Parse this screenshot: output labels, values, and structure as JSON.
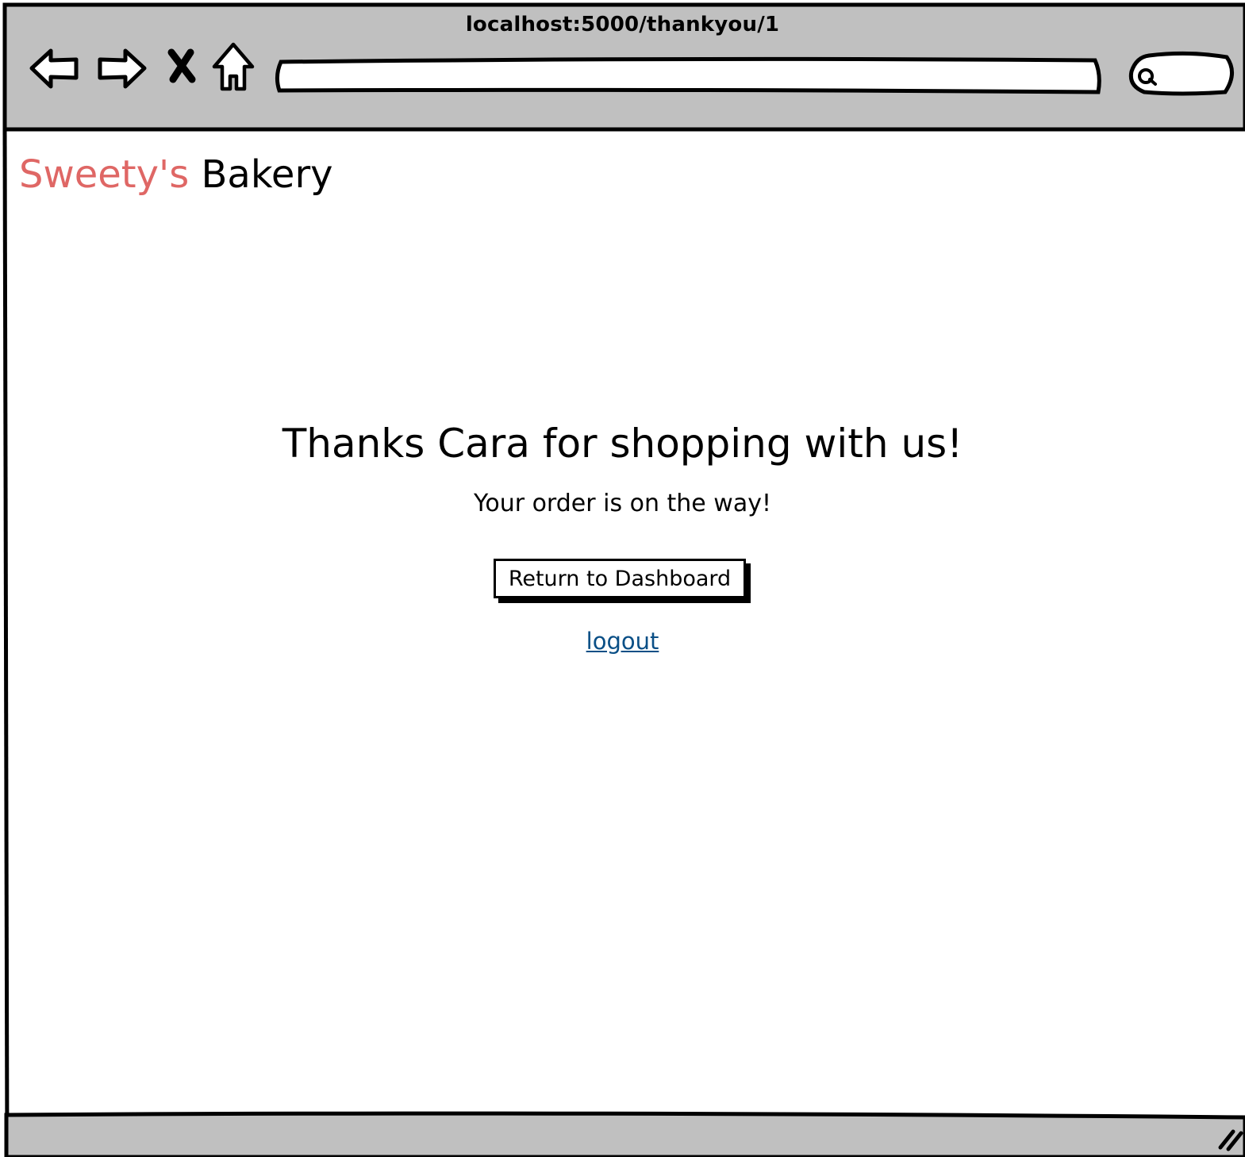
{
  "browser": {
    "url": "localhost:5000/thankyou/1",
    "colors": {
      "chrome": "#c0c0c0",
      "stroke": "#000000"
    },
    "icons": [
      "back-arrow-icon",
      "forward-arrow-icon",
      "close-x-icon",
      "home-icon",
      "search-icon",
      "resize-grip-icon"
    ]
  },
  "header": {
    "brand_part1": "Sweety's",
    "brand_part2": "Bakery",
    "brand_color": "#df6765"
  },
  "main": {
    "heading": "Thanks Cara for shopping with us!",
    "subheading": "Your order is on the way!",
    "dashboard_button": "Return to Dashboard",
    "logout_link": "logout",
    "link_color": "#0a4f86"
  }
}
